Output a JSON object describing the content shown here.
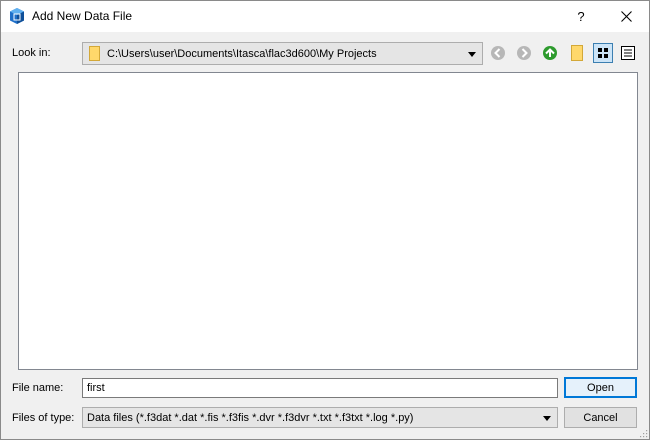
{
  "window": {
    "title": "Add New Data File",
    "help_glyph": "?"
  },
  "look_in": {
    "label": "Look in:",
    "path": "C:\\Users\\user\\Documents\\Itasca\\flac3d600\\My Projects"
  },
  "toolbar": {
    "icons": [
      "back-arrow-icon",
      "forward-arrow-icon",
      "parent-folder-up-icon",
      "new-folder-icon",
      "list-view-icon",
      "detail-view-icon"
    ],
    "active_view": "list-view"
  },
  "file_name": {
    "label": "File name:",
    "value": "first"
  },
  "file_type": {
    "label": "Files of type:",
    "selected": "Data files (*.f3dat *.dat *.fis *.f3fis *.dvr *.f3dvr *.txt *.f3txt *.log *.py)"
  },
  "buttons": {
    "open": "Open",
    "cancel": "Cancel"
  },
  "colors": {
    "title_bar": "#ffffff",
    "dialog_bg": "#f0f0f0",
    "accent": "#0078d7",
    "up_arrow_green": "#2e9b2e",
    "folder_yellow": "#ffd86b"
  }
}
